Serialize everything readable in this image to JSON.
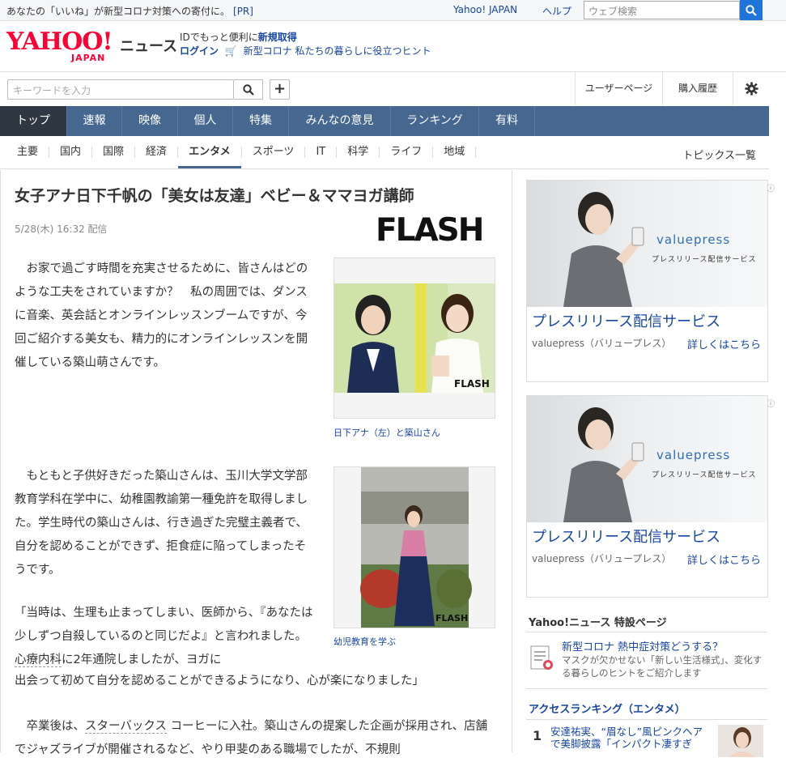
{
  "topbar": {
    "promo": "あなたの「いいね」が新型コロナ対策への寄付に。",
    "pr": "[PR]",
    "yahoo_japan": "Yahoo! JAPAN",
    "help": "ヘルプ",
    "web_search_placeholder": "ウェブ検索"
  },
  "header": {
    "logo_main": "YAHOO!",
    "logo_sub": "JAPAN",
    "logo_news": "ニュース",
    "msg": "IDでもっと便利に",
    "register": "新規取得",
    "login": "ログイン",
    "covid_link": "新型コロナ 私たちの暮らしに役立つヒント"
  },
  "search": {
    "placeholder": "キーワードを入力",
    "user_page": "ユーザーページ",
    "history": "購入履歴"
  },
  "main_nav": [
    "トップ",
    "速報",
    "映像",
    "個人",
    "特集",
    "みんなの意見",
    "ランキング",
    "有料"
  ],
  "sub_nav": [
    "主要",
    "国内",
    "国際",
    "経済",
    "エンタメ",
    "スポーツ",
    "IT",
    "科学",
    "ライフ",
    "地域"
  ],
  "topics_list": "トピックス一覧",
  "article": {
    "title": "女子アナ日下千帆の「美女は友達」ベビー＆ママヨガ講師",
    "date": "5/28(木) 16:32 配信",
    "source_logo": "FLASH",
    "p1": "　お家で過ごす時間を充実させるために、皆さんはどのような工夫をされていますか？　私の周囲では、ダンスに音楽、英会話とオンラインレッスンブームですが、今回ご紹介する美女も、精力的にオンラインレッスンを開催している築山萌さんです。",
    "p2": "　もともと子供好きだった築山さんは、玉川大学文学部教育学科在学中に、幼稚園教諭第一種免許を取得しました。学生時代の築山さんは、行き過ぎた完璧主義者で、自分を認めることができず、拒食症に陥ってしまったそうです。",
    "p3a": "「当時は、生理も止まってしまい、医師から、『あなたは少しずつ自殺しているのと同じだよ』と言われました。",
    "p3b": "心療内科",
    "p3c": "に2年通院しましたが、ヨガに",
    "p3d": "出会って初めて自分を認めることができるようになり、心が楽になりました」",
    "p4a": "　卒業後は、",
    "p4b": "スターバックス",
    "p4c": " コーヒーに入社。築山さんの提案した企画が採用され、店舗でジャズライブが開催されるなど、やり甲斐のある職場でしたが、不規則",
    "caption1": "日下アナ（左）と築山さん",
    "caption2": "幼児教育を学ぶ",
    "photo_mark": "FLASH"
  },
  "ads": [
    {
      "brand": "valuepress",
      "tagline": "プレスリリース配信サービス",
      "title": "プレスリリース配信サービス",
      "source": "valuepress（バリュープレス）",
      "more": "詳しくはこちら"
    },
    {
      "brand": "valuepress",
      "tagline": "プレスリリース配信サービス",
      "title": "プレスリリース配信サービス",
      "source": "valuepress（バリュープレス）",
      "more": "詳しくはこちら"
    }
  ],
  "special": {
    "heading": "Yahoo!ニュース 特設ページ",
    "title": "新型コロナ 熱中症対策どうする？",
    "desc": "マスクが欠かせない「新しい生活様式」、変化する暮らしのヒントをご紹介します"
  },
  "ranking": {
    "heading": "アクセスランキング（エンタメ）",
    "items": [
      {
        "rank": "1",
        "title": "安達祐実、“眉なし”風ピンクヘアで美脚披露「インパクト凄すぎ"
      }
    ]
  },
  "colors": {
    "nav_bg": "#46678f",
    "nav_active": "#2f3842",
    "link": "#1846a3",
    "logo_red": "#ff0033",
    "search_btn": "#1f74d9"
  }
}
